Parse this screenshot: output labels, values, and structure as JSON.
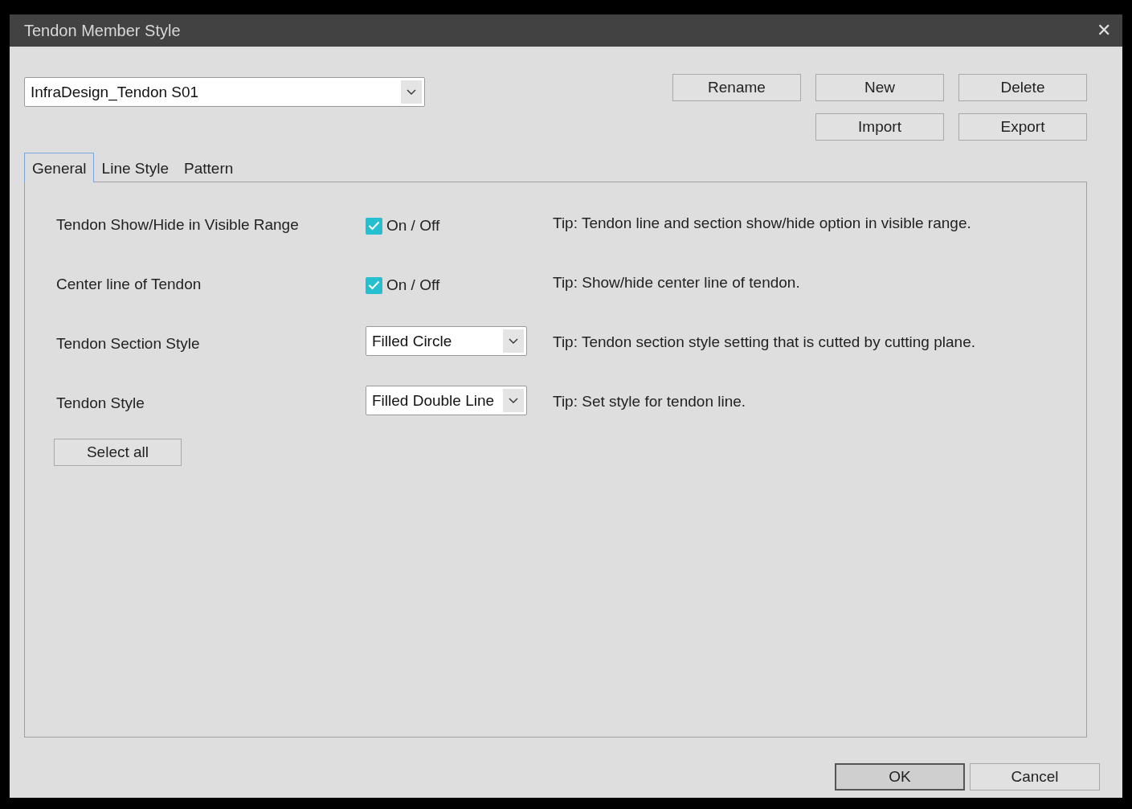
{
  "window": {
    "title": "Tendon Member Style",
    "close": "✕"
  },
  "style_select": {
    "value": "InfraDesign_Tendon S01"
  },
  "actions": [
    {
      "label": "Rename"
    },
    {
      "label": "New"
    },
    {
      "label": "Delete"
    },
    {
      "label": "Import"
    },
    {
      "label": "Export"
    }
  ],
  "tabs": [
    {
      "label": "General",
      "selected": true
    },
    {
      "label": "Line Style",
      "selected": false
    },
    {
      "label": "Pattern",
      "selected": false
    }
  ],
  "settings": [
    {
      "kind": "checkbox",
      "label": "Tendon Show/Hide in Visible Range",
      "control_text": "On / Off",
      "checked": true,
      "tip": "Tip: Tendon line and section show/hide option in visible range."
    },
    {
      "kind": "checkbox",
      "label": "Center line of Tendon",
      "control_text": "On / Off",
      "checked": true,
      "tip": "Tip: Show/hide center line of tendon."
    },
    {
      "kind": "dropdown",
      "label": "Tendon Section Style",
      "control_text": "Filled Circle",
      "tip": "Tip: Tendon section style setting that is cutted by cutting plane."
    },
    {
      "kind": "dropdown",
      "label": "Tendon Style",
      "control_text": "Filled Double Line",
      "tip": "Tip: Set style for tendon line."
    }
  ],
  "select_all": "Select all",
  "footer_buttons": [
    {
      "label": "OK",
      "default": true
    },
    {
      "label": "Cancel",
      "default": false
    }
  ]
}
